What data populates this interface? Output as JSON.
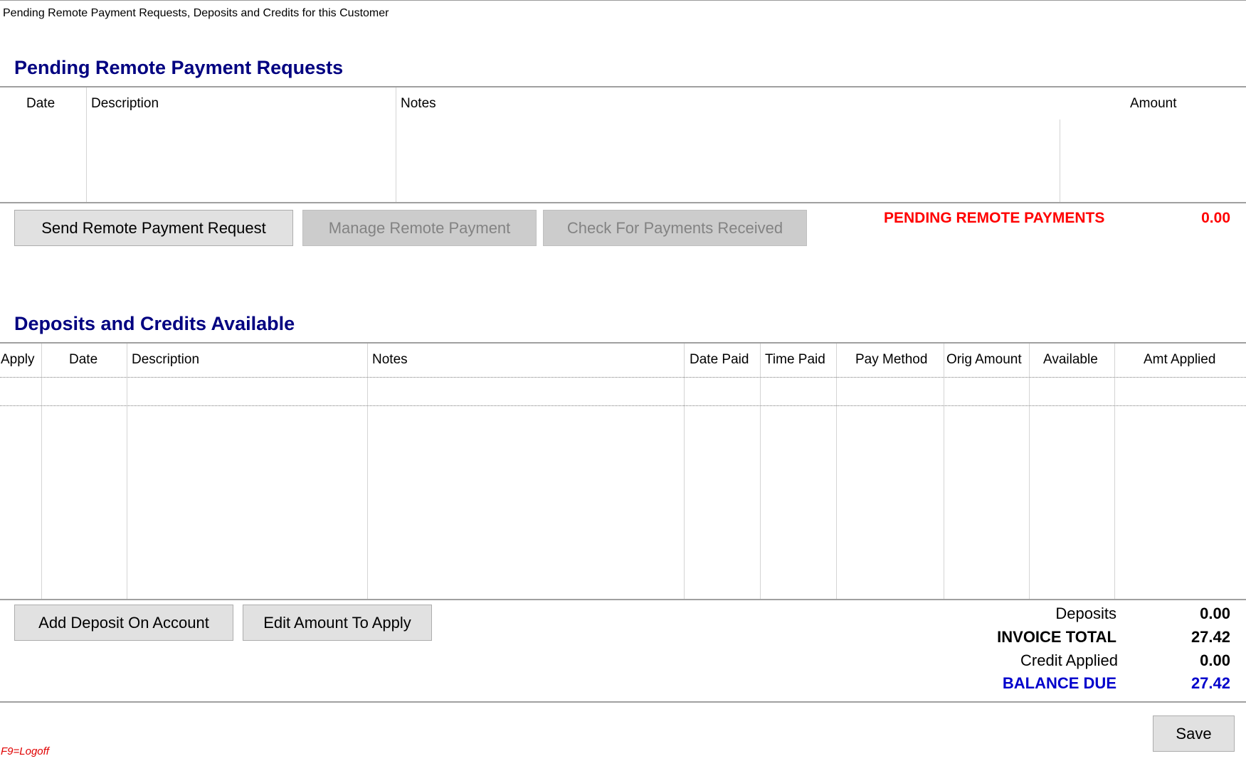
{
  "window": {
    "title": "Pending Remote Payment Requests, Deposits and Credits for this Customer"
  },
  "pending": {
    "title": "Pending Remote Payment Requests",
    "columns": [
      "Date",
      "Description",
      "Notes",
      "Amount"
    ],
    "buttons": {
      "send": "Send Remote Payment Request",
      "manage": "Manage Remote Payment",
      "check": "Check For Payments Received"
    },
    "total_label": "PENDING REMOTE PAYMENTS",
    "total_value": "0.00"
  },
  "deposits": {
    "title": "Deposits and Credits Available",
    "columns": [
      "Apply",
      "Date",
      "Description",
      "Notes",
      "Date Paid",
      "Time Paid",
      "Pay Method",
      "Orig Amount",
      "Available",
      "Amt Applied"
    ],
    "buttons": {
      "add": "Add Deposit On Account",
      "edit": "Edit Amount To Apply"
    }
  },
  "summary": {
    "deposits_label": "Deposits",
    "deposits_value": "0.00",
    "invoice_total_label": "INVOICE TOTAL",
    "invoice_total_value": "27.42",
    "credit_applied_label": "Credit Applied",
    "credit_applied_value": "0.00",
    "balance_due_label": "BALANCE DUE",
    "balance_due_value": "27.42"
  },
  "footer": {
    "save": "Save",
    "logoff_hint": "F9=Logoff"
  },
  "colors": {
    "heading": "#000080",
    "alert": "#ff0000",
    "balance": "#0000cc"
  }
}
